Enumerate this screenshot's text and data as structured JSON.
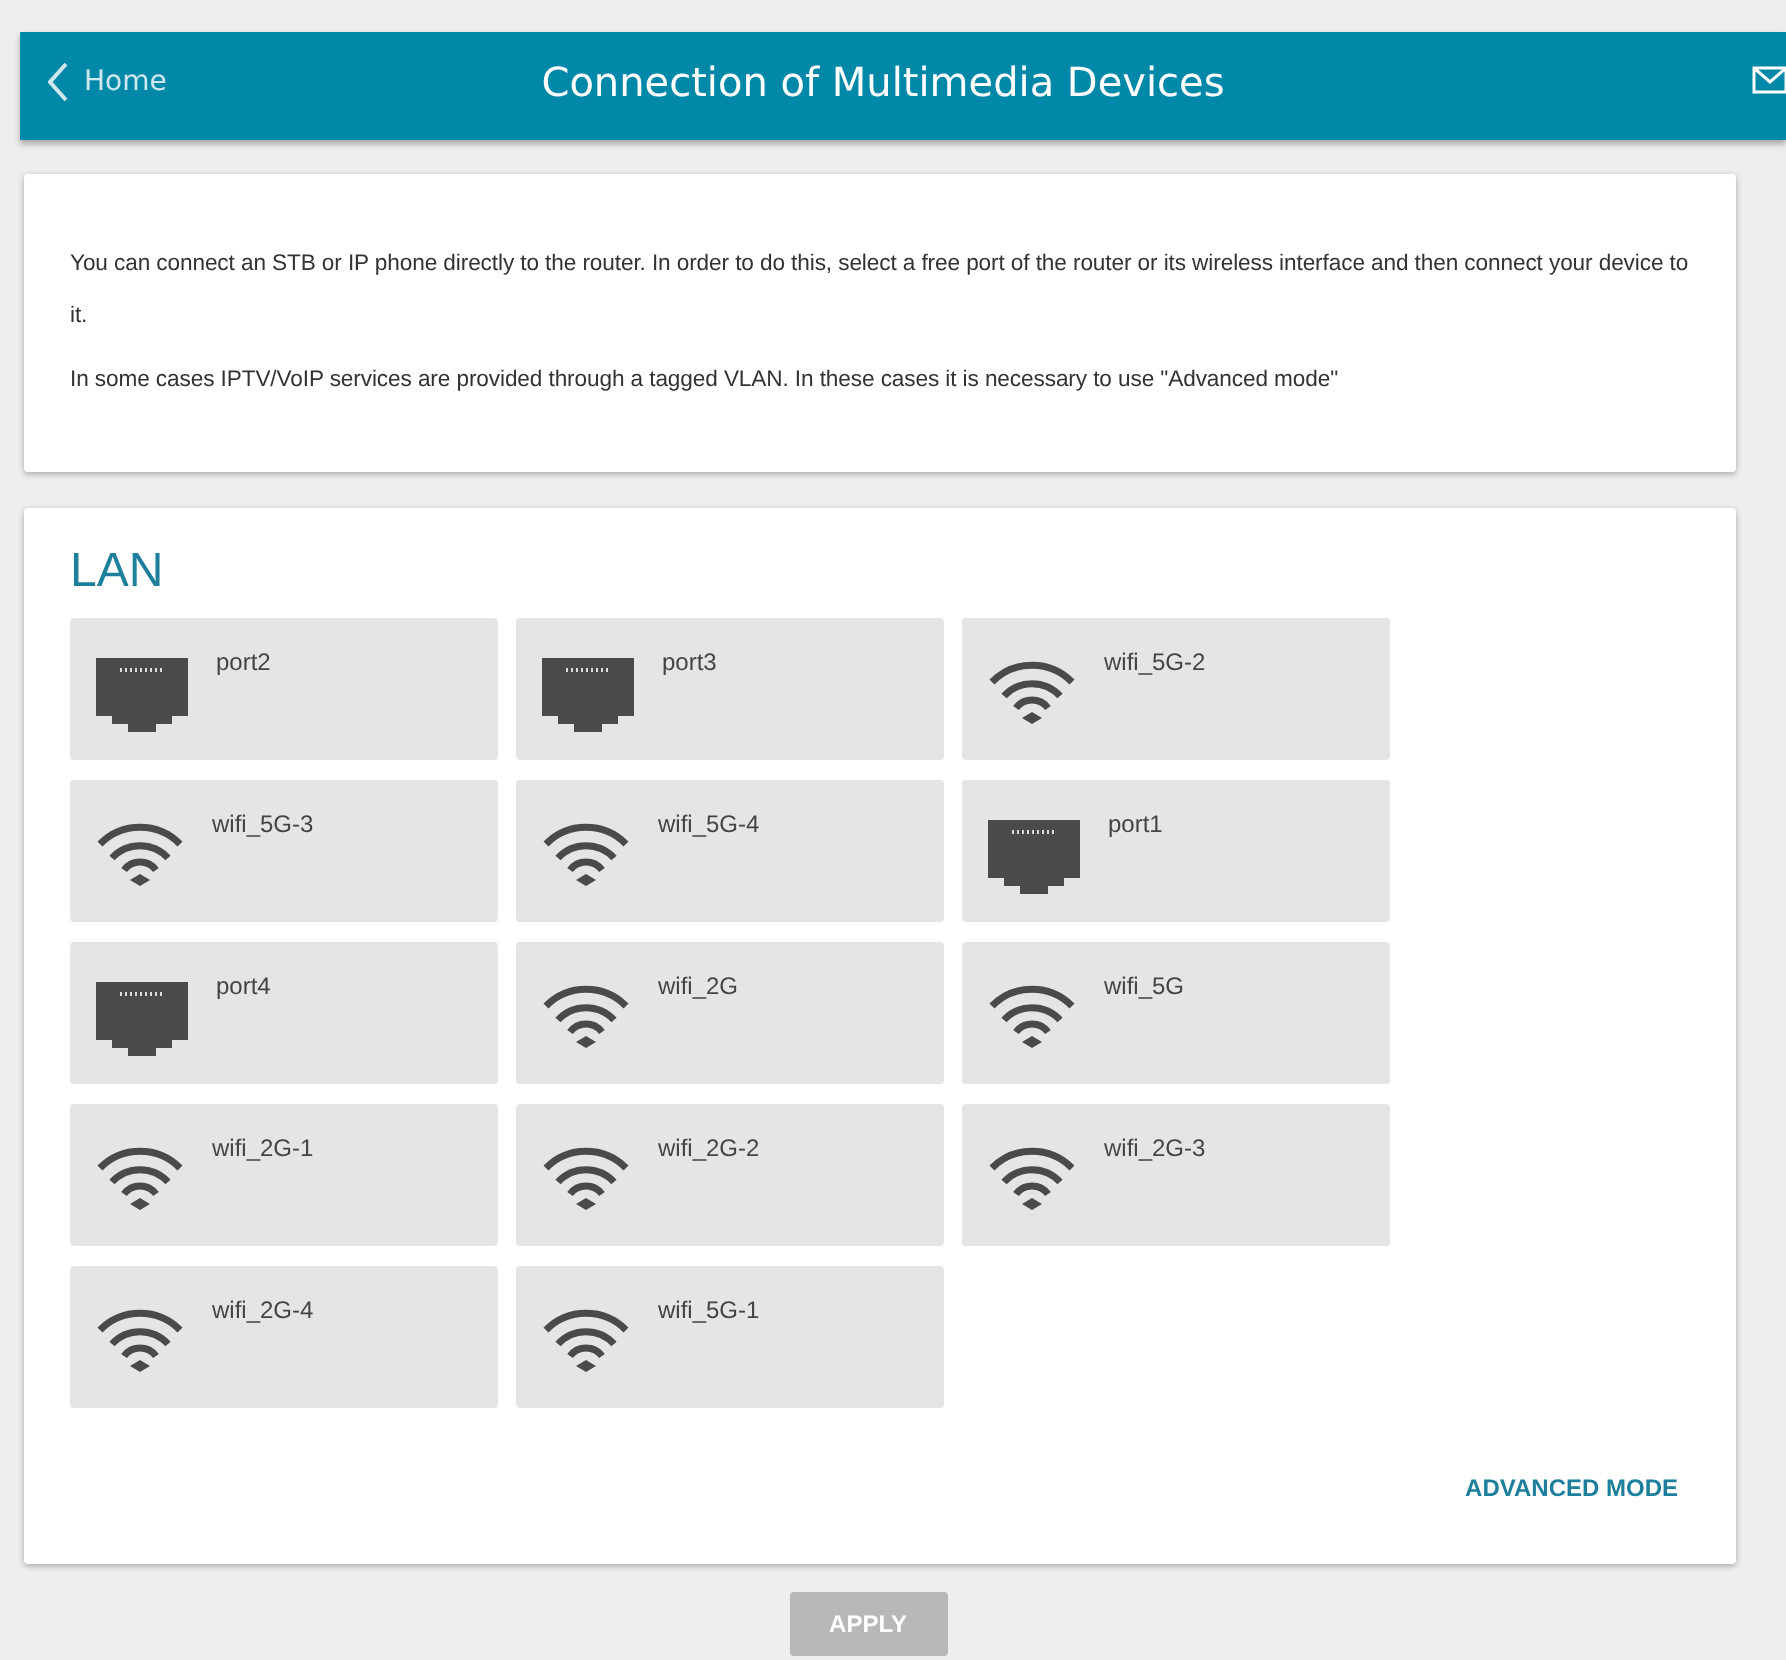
{
  "header": {
    "back_label": "Home",
    "title": "Connection of Multimedia Devices"
  },
  "info": [
    "You can connect an STB or IP phone directly to the router. In order to do this, select a free port of the router or its wireless interface and then connect your device to it.",
    "In some cases IPTV/VoIP services are provided through a tagged VLAN. In these cases it is necessary to use \"Advanced mode\""
  ],
  "lan": {
    "title": "LAN",
    "interfaces": [
      {
        "kind": "port",
        "name": "port2"
      },
      {
        "kind": "port",
        "name": "port3"
      },
      {
        "kind": "wifi",
        "name": "wifi_5G-2"
      },
      {
        "kind": "wifi",
        "name": "wifi_5G-3"
      },
      {
        "kind": "wifi",
        "name": "wifi_5G-4"
      },
      {
        "kind": "port",
        "name": "port1"
      },
      {
        "kind": "port",
        "name": "port4"
      },
      {
        "kind": "wifi",
        "name": "wifi_2G"
      },
      {
        "kind": "wifi",
        "name": "wifi_5G"
      },
      {
        "kind": "wifi",
        "name": "wifi_2G-1"
      },
      {
        "kind": "wifi",
        "name": "wifi_2G-2"
      },
      {
        "kind": "wifi",
        "name": "wifi_2G-3"
      },
      {
        "kind": "wifi",
        "name": "wifi_2G-4"
      },
      {
        "kind": "wifi",
        "name": "wifi_5G-1"
      }
    ],
    "advanced_link": "ADVANCED MODE"
  },
  "apply_button": {
    "label": "APPLY",
    "disabled": true
  }
}
